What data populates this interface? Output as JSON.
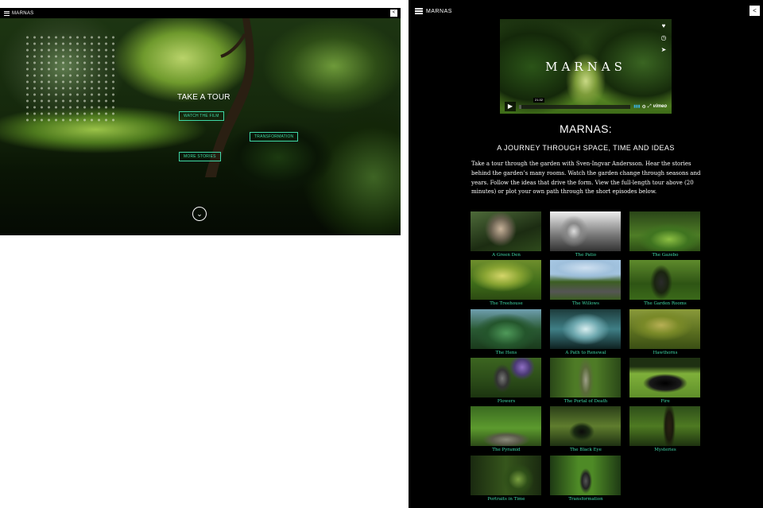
{
  "left": {
    "brand": "MARNAS",
    "share_icon": "share-icon",
    "hero": {
      "heading": "TAKE A TOUR",
      "buttons": [
        "WATCH THE FILM",
        "TRANSFORMATION",
        "MORE STORIES"
      ],
      "scroll_icon": "chevron-down-icon"
    }
  },
  "right": {
    "brand": "MARNAS",
    "share_icon": "share-icon",
    "video": {
      "title": "MARNAS",
      "timecode": "21:32",
      "provider": "vimeo",
      "icons": [
        "heart-icon",
        "clock-icon",
        "send-icon"
      ],
      "progress": 0.02
    },
    "title": "MARNAS:",
    "subtitle": "A JOURNEY THROUGH SPACE, TIME AND IDEAS",
    "intro": "Take a tour through the garden with Sven-Ingvar Andersson. Hear the stories behind the garden’s many rooms. Watch the garden change through seasons and years. Follow the ideas that drive the form. View the full-length tour above (20 minutes) or plot your own path through the short episodes below.",
    "episodes": [
      {
        "caption": "A Green Den",
        "bw": false
      },
      {
        "caption": "The Patio",
        "bw": true
      },
      {
        "caption": "The Gazebo",
        "bw": false
      },
      {
        "caption": "The Treehouse",
        "bw": false
      },
      {
        "caption": "The Willows",
        "bw": false
      },
      {
        "caption": "The Garden Rooms",
        "bw": false
      },
      {
        "caption": "The Hens",
        "bw": false
      },
      {
        "caption": "A Path to Renewal",
        "bw": false
      },
      {
        "caption": "Hawthorns",
        "bw": false
      },
      {
        "caption": "Flowers",
        "bw": false
      },
      {
        "caption": "The Portal of Death",
        "bw": false
      },
      {
        "caption": "Fire",
        "bw": false
      },
      {
        "caption": "The Pyramid",
        "bw": false
      },
      {
        "caption": "The Black Eye",
        "bw": false
      },
      {
        "caption": "Mysteries",
        "bw": false
      },
      {
        "caption": "Portraits in Time",
        "bw": false
      },
      {
        "caption": "Transformation",
        "bw": false
      }
    ]
  }
}
